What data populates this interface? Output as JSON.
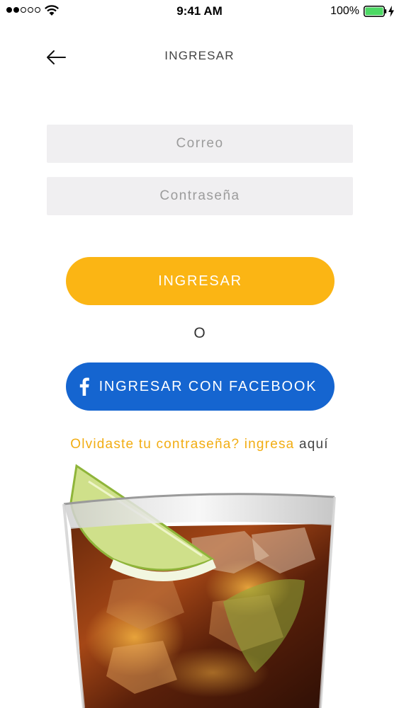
{
  "status_bar": {
    "signal_bars_filled": 2,
    "signal_bars_total": 5,
    "wifi_icon": "wifi-icon",
    "time": "9:41 AM",
    "battery_percent": "100%",
    "battery_icon": "battery-icon",
    "charging_icon": "bolt-icon"
  },
  "nav": {
    "back_icon": "arrow-left-icon",
    "title": "INGRESAR"
  },
  "form": {
    "email_placeholder": "Correo",
    "email_value": "",
    "password_placeholder": "Contraseña",
    "password_value": "",
    "login_label": "INGRESAR",
    "or_label": "O",
    "facebook_icon": "facebook-icon",
    "facebook_label": "INGRESAR CON FACEBOOK",
    "forgot_text": "Olvidaste tu contraseña? ingresa",
    "forgot_link": "aquí"
  },
  "illustration": {
    "name": "drink-glass-image"
  },
  "colors": {
    "accent_yellow": "#fbb514",
    "facebook_blue": "#1565d0",
    "input_bg": "#f0eff1",
    "battery_green": "#4cd964"
  }
}
